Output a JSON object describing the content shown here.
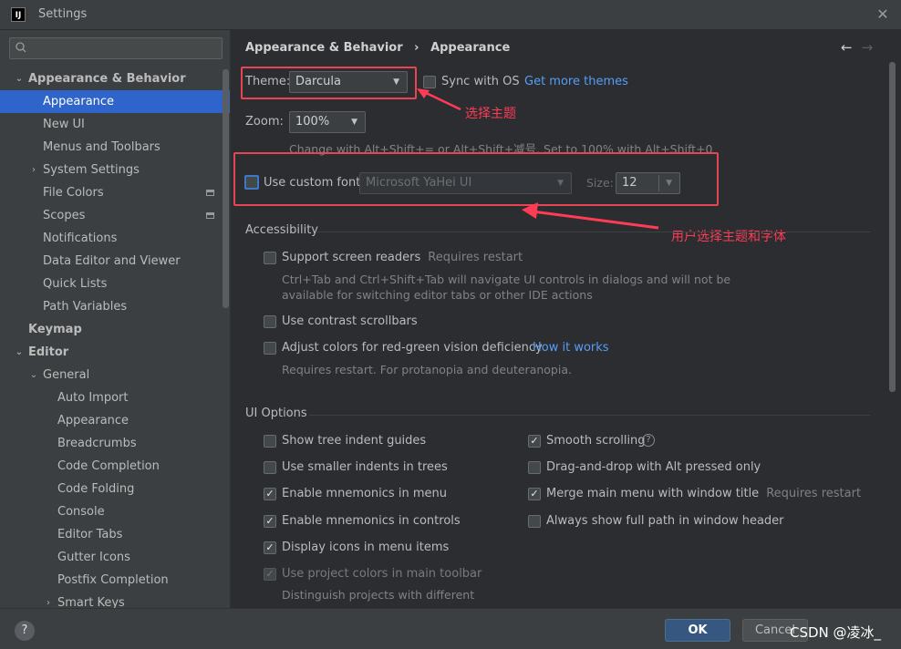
{
  "window": {
    "title": "Settings",
    "app_icon_text": "IJ"
  },
  "search": {
    "placeholder": ""
  },
  "sidebar": {
    "items": [
      {
        "label": "Appearance & Behavior"
      },
      {
        "label": "Appearance"
      },
      {
        "label": "New UI"
      },
      {
        "label": "Menus and Toolbars"
      },
      {
        "label": "System Settings"
      },
      {
        "label": "File Colors"
      },
      {
        "label": "Scopes"
      },
      {
        "label": "Notifications"
      },
      {
        "label": "Data Editor and Viewer"
      },
      {
        "label": "Quick Lists"
      },
      {
        "label": "Path Variables"
      },
      {
        "label": "Keymap"
      },
      {
        "label": "Editor"
      },
      {
        "label": "General"
      },
      {
        "label": "Auto Import"
      },
      {
        "label": "Appearance"
      },
      {
        "label": "Breadcrumbs"
      },
      {
        "label": "Code Completion"
      },
      {
        "label": "Code Folding"
      },
      {
        "label": "Console"
      },
      {
        "label": "Editor Tabs"
      },
      {
        "label": "Gutter Icons"
      },
      {
        "label": "Postfix Completion"
      },
      {
        "label": "Smart Keys"
      }
    ]
  },
  "breadcrumb": {
    "parent": "Appearance & Behavior",
    "separator": "›",
    "current": "Appearance"
  },
  "theme": {
    "label": "Theme:",
    "value": "Darcula",
    "sync_label": "Sync with OS",
    "get_more": "Get more themes"
  },
  "zoom": {
    "label": "Zoom:",
    "value": "100%",
    "hint": "Change with Alt+Shift+= or Alt+Shift+减号. Set to 100% with Alt+Shift+0"
  },
  "font": {
    "use_custom_label": "Use custom font:",
    "value": "Microsoft YaHei UI",
    "size_label": "Size:",
    "size_value": "12"
  },
  "accessibility": {
    "title": "Accessibility",
    "screen_readers": "Support screen readers",
    "screen_readers_note": "Requires restart",
    "screen_readers_hint_1": "Ctrl+Tab and Ctrl+Shift+Tab will navigate UI controls in dialogs and will not be",
    "screen_readers_hint_2": "available for switching editor tabs or other IDE actions",
    "contrast_scrollbars": "Use contrast scrollbars",
    "adjust_colors": "Adjust colors for red-green vision deficiency",
    "how_it_works": "How it works",
    "adjust_hint": "Requires restart. For protanopia and deuteranopia."
  },
  "ui_options": {
    "title": "UI Options",
    "left": [
      {
        "label": "Show tree indent guides",
        "checked": false
      },
      {
        "label": "Use smaller indents in trees",
        "checked": false
      },
      {
        "label": "Enable mnemonics in menu",
        "checked": true
      },
      {
        "label": "Enable mnemonics in controls",
        "checked": true
      },
      {
        "label": "Display icons in menu items",
        "checked": true
      },
      {
        "label": "Use project colors in main toolbar",
        "checked": true
      }
    ],
    "right": [
      {
        "label": "Smooth scrolling",
        "checked": true
      },
      {
        "label": "Drag-and-drop with Alt pressed only",
        "checked": false
      },
      {
        "label": "Merge main menu with window title",
        "checked": true,
        "note": "Requires restart"
      },
      {
        "label": "Always show full path in window header",
        "checked": false
      }
    ],
    "project_colors_hint": "Distinguish projects with different"
  },
  "annotations": {
    "select_theme": "选择主题",
    "select_theme_and_font": "用户选择主题和字体"
  },
  "footer": {
    "ok": "OK",
    "cancel": "Cancel",
    "help": "?"
  },
  "watermark": "CSDN @凌冰_",
  "colors": {
    "accent_blue": "#2f65ca",
    "link_blue": "#589df6",
    "annotation_red": "#e64553",
    "ok_button": "#365880"
  }
}
